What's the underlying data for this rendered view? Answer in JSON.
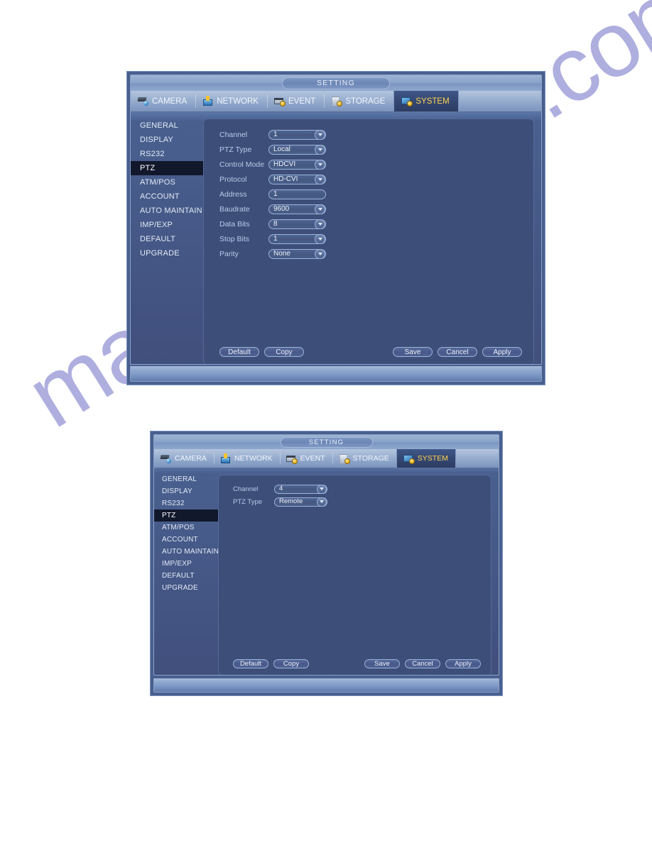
{
  "watermark": {
    "text": "manualarchive.com"
  },
  "dialog1": {
    "title": "SETTING",
    "tabs": [
      {
        "label": "CAMERA",
        "icon": "camera-icon",
        "active": false
      },
      {
        "label": "NETWORK",
        "icon": "network-icon",
        "active": false
      },
      {
        "label": "EVENT",
        "icon": "event-icon",
        "active": false
      },
      {
        "label": "STORAGE",
        "icon": "storage-icon",
        "active": false
      },
      {
        "label": "SYSTEM",
        "icon": "system-icon",
        "active": true
      }
    ],
    "menu": [
      {
        "label": "GENERAL",
        "active": false
      },
      {
        "label": "DISPLAY",
        "active": false
      },
      {
        "label": "RS232",
        "active": false
      },
      {
        "label": "PTZ",
        "active": true
      },
      {
        "label": "ATM/POS",
        "active": false
      },
      {
        "label": "ACCOUNT",
        "active": false
      },
      {
        "label": "AUTO MAINTAIN",
        "active": false
      },
      {
        "label": "IMP/EXP",
        "active": false
      },
      {
        "label": "DEFAULT",
        "active": false
      },
      {
        "label": "UPGRADE",
        "active": false
      }
    ],
    "fields": [
      {
        "label": "Channel",
        "value": "1",
        "type": "select"
      },
      {
        "label": "PTZ Type",
        "value": "Local",
        "type": "select"
      },
      {
        "label": "Control Mode",
        "value": "HDCVI",
        "type": "select"
      },
      {
        "label": "Protocol",
        "value": "HD-CVI",
        "type": "select"
      },
      {
        "label": "Address",
        "value": "1",
        "type": "text"
      },
      {
        "label": "Baudrate",
        "value": "9600",
        "type": "select"
      },
      {
        "label": "Data Bits",
        "value": "8",
        "type": "select"
      },
      {
        "label": "Stop Bits",
        "value": "1",
        "type": "select"
      },
      {
        "label": "Parity",
        "value": "None",
        "type": "select"
      }
    ],
    "buttons_left": [
      {
        "label": "Default"
      },
      {
        "label": "Copy"
      }
    ],
    "buttons_right": [
      {
        "label": "Save"
      },
      {
        "label": "Cancel"
      },
      {
        "label": "Apply"
      }
    ]
  },
  "dialog2": {
    "title": "SETTING",
    "tabs": [
      {
        "label": "CAMERA",
        "icon": "camera-icon",
        "active": false
      },
      {
        "label": "NETWORK",
        "icon": "network-icon",
        "active": false
      },
      {
        "label": "EVENT",
        "icon": "event-icon",
        "active": false
      },
      {
        "label": "STORAGE",
        "icon": "storage-icon",
        "active": false
      },
      {
        "label": "SYSTEM",
        "icon": "system-icon",
        "active": true
      }
    ],
    "menu": [
      {
        "label": "GENERAL",
        "active": false
      },
      {
        "label": "DISPLAY",
        "active": false
      },
      {
        "label": "RS232",
        "active": false
      },
      {
        "label": "PTZ",
        "active": true
      },
      {
        "label": "ATM/POS",
        "active": false
      },
      {
        "label": "ACCOUNT",
        "active": false
      },
      {
        "label": "AUTO MAINTAIN",
        "active": false
      },
      {
        "label": "IMP/EXP",
        "active": false
      },
      {
        "label": "DEFAULT",
        "active": false
      },
      {
        "label": "UPGRADE",
        "active": false
      }
    ],
    "fields": [
      {
        "label": "Channel",
        "value": "4",
        "type": "select"
      },
      {
        "label": "PTZ Type",
        "value": "Remote",
        "type": "select"
      }
    ],
    "buttons_left": [
      {
        "label": "Default"
      },
      {
        "label": "Copy"
      }
    ],
    "buttons_right": [
      {
        "label": "Save"
      },
      {
        "label": "Cancel"
      },
      {
        "label": "Apply"
      }
    ]
  },
  "colors": {
    "dialog_frame": "#49608f",
    "panel_bg": "#3d4e79",
    "accent_active_tab_text": "#ffd24d",
    "menu_active_bg": "#12182b",
    "label_text": "#b9cbe8",
    "watermark": "#3f3fb4"
  }
}
